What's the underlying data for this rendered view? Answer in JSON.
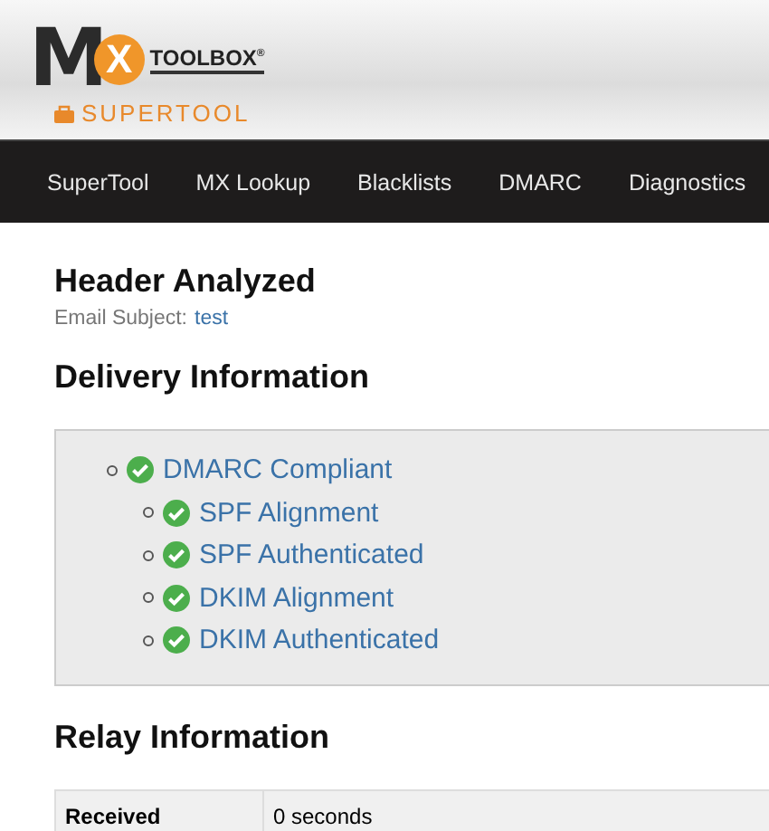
{
  "logo": {
    "letter_1": "M",
    "letter_2": "X",
    "wordmark": "TOOLBOX",
    "registered": "®",
    "product": "SUPERTOOL"
  },
  "nav": [
    {
      "label": "SuperTool"
    },
    {
      "label": "MX Lookup"
    },
    {
      "label": "Blacklists"
    },
    {
      "label": "DMARC"
    },
    {
      "label": "Diagnostics"
    }
  ],
  "header": {
    "title": "Header Analyzed",
    "subject_label": "Email Subject:",
    "subject": "test"
  },
  "delivery": {
    "title": "Delivery Information",
    "items": [
      {
        "label": "DMARC Compliant",
        "passed": true,
        "children": [
          {
            "label": "SPF Alignment",
            "passed": true
          },
          {
            "label": "SPF Authenticated",
            "passed": true
          },
          {
            "label": "DKIM Alignment",
            "passed": true
          },
          {
            "label": "DKIM Authenticated",
            "passed": true
          }
        ]
      }
    ]
  },
  "relay": {
    "title": "Relay Information",
    "rows": [
      {
        "label": "Received",
        "value": "0 seconds"
      }
    ]
  }
}
